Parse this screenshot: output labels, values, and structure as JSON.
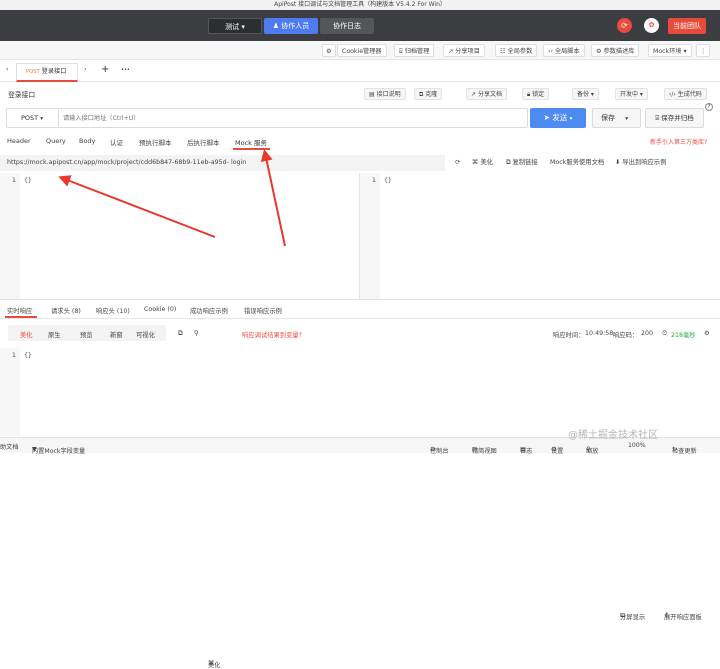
{
  "window": {
    "title": "ApiPost 接口调试与文档管理工具（构建版本 V5.4.2 For Win）"
  },
  "topbar": {
    "project_label": "测试",
    "collab_label": "协作人员",
    "log_label": "协作日志",
    "user_label": "当前团队",
    "colors": {
      "bg": "#3c3d40",
      "primary": "#4e7cf0",
      "danger": "#e84b3c"
    }
  },
  "toolbar": {
    "items": [
      "Cookie管理器",
      "归档管理",
      "分享项目",
      "全局参数",
      "全局脚本",
      "参数描述库",
      "Mock环境"
    ]
  },
  "tabs": {
    "active": "登录接口",
    "method_tag": "POST",
    "add": "+",
    "more": "•••"
  },
  "request": {
    "name": "登录接口",
    "actions": [
      "接口说明",
      "克隆",
      "分享文档",
      "锁定",
      "备份",
      "开发中",
      "生成代码"
    ],
    "method": "POST",
    "url_placeholder": "请输入接口地址（Ctrl+U）",
    "send_label": "发送",
    "save_label": "保存",
    "save_archive_label": "保存并归档"
  },
  "subtabs": {
    "items": [
      "Header",
      "Query",
      "Body",
      "认证",
      "预执行脚本",
      "后执行脚本",
      "Mock 服务"
    ],
    "link": "新手引入第三方类库?"
  },
  "mock": {
    "url": "https://mock.apipost.cn/app/mock/project/cdd6b847-68b9-11eb-a95d-  login",
    "actions": [
      "美化",
      "复制链接",
      "Mock服务使用文档",
      "导出到响应示例"
    ]
  },
  "editors": {
    "left": {
      "line": "1",
      "code": "{}"
    },
    "right": {
      "line": "1",
      "code": "{}"
    }
  },
  "response": {
    "tabs": [
      "实时响应",
      "请求头 (8)",
      "响应头 (10)",
      "Cookie (0)",
      "成功响应示例",
      "错误响应示例"
    ],
    "right_actions": [
      "分屏显示",
      "展开响应面板"
    ],
    "view_tabs": [
      "美化",
      "原生",
      "预览",
      "新窗",
      "可视化"
    ],
    "beautify": "美化",
    "hint": "响应调试结果到变量?",
    "time_label": "响应时间：",
    "time_value": "10:49:58",
    "code_label": "响应码：",
    "code_value": "200",
    "size_value": "218毫秒",
    "line": "1",
    "code": "{}"
  },
  "statusbar": {
    "left": "助文档",
    "mock_vars": "内置Mock字段变量",
    "items": [
      "控制台",
      "精简视图",
      "日志",
      "设置",
      "缩放",
      "100%",
      "检查更新"
    ],
    "watermark": "@稀土掘金技术社区"
  }
}
